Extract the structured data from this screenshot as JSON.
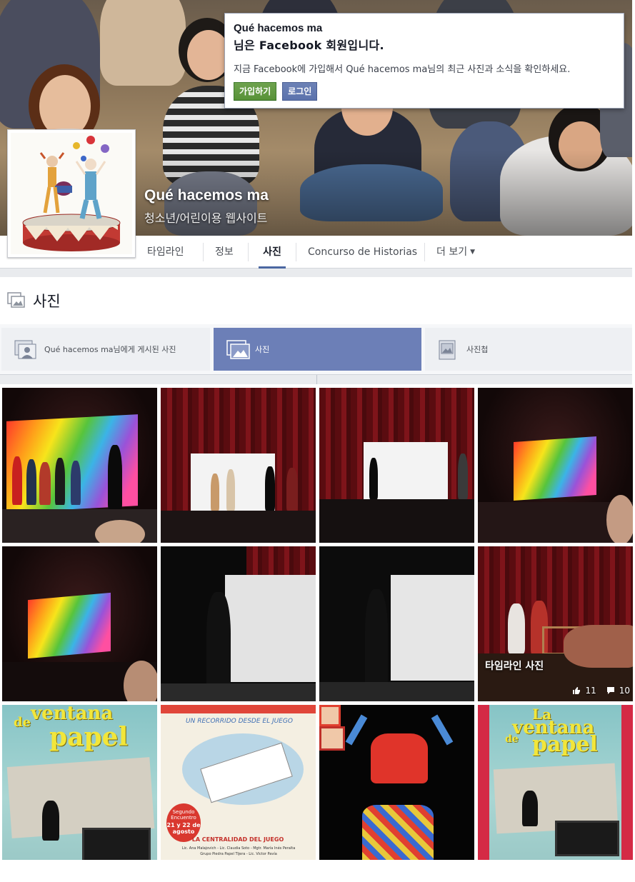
{
  "page": {
    "name": "Qué hacemos ma",
    "category": "청소년/어린이용 웹사이트"
  },
  "join_popup": {
    "title": "Qué hacemos ma",
    "subtitle": "님은 Facebook 회원입니다.",
    "message": "지금 Facebook에 가입해서 Qué hacemos ma님의 최근 사진과 소식을 확인하세요.",
    "signup_label": "가입하기",
    "login_label": "로그인"
  },
  "tabs": [
    {
      "label": "타임라인"
    },
    {
      "label": "정보"
    },
    {
      "label": "사진"
    },
    {
      "label": "Concurso de Historias"
    },
    {
      "label": "더 보기"
    }
  ],
  "photos_section": {
    "title": "사진"
  },
  "subtabs": [
    {
      "label": "Qué hacemos ma님에게 게시된 사진"
    },
    {
      "label": "사진"
    },
    {
      "label": "사진첩"
    }
  ],
  "featured_photo": {
    "caption": "타임라인 사진",
    "likes": "11",
    "comments": "10"
  },
  "posters": {
    "ventana_line1": "ventana",
    "ventana_line2": "de",
    "ventana_line3": "papel",
    "la_ventana_line0": "La",
    "recorrido": "UN RECORRIDO DESDE EL JUEGO",
    "centralidad": "LA CENTRALIDAD DEL JUEGO",
    "encuentro": "Segundo Encuentro",
    "fecha": "21 y 22 de agosto",
    "names1": "Lic. Ana Malajovich - Lic. Claudia Soto - Mgtr. María Inés Peralta",
    "names2": "Grupo Piedra Papel Tijera - Lic. Victor Pavía"
  },
  "colors": {
    "facebook_blue": "#4b67a1",
    "active_subtab": "#6c7fb7",
    "signup_green": "#5f9a41",
    "login_blue": "#6478b0"
  }
}
